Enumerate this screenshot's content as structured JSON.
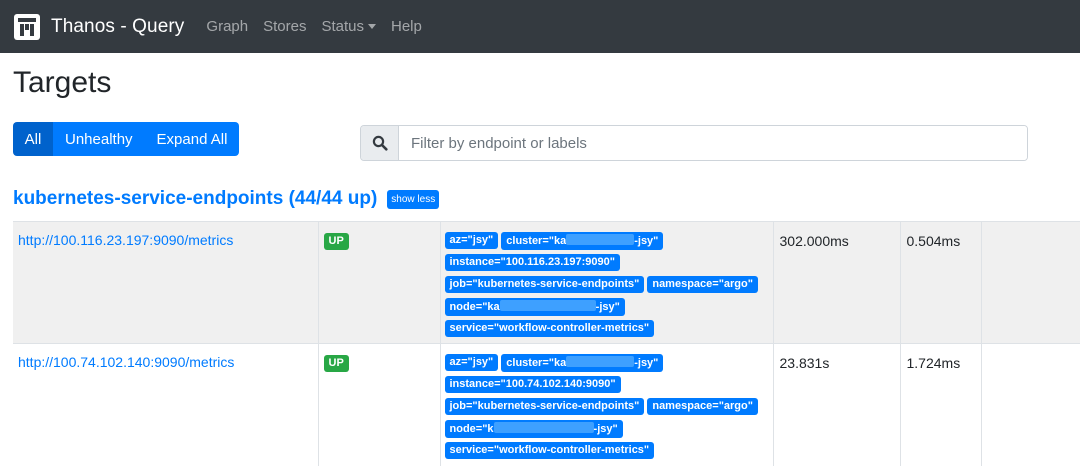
{
  "nav": {
    "brand": "Thanos - Query",
    "items": [
      {
        "label": "Graph"
      },
      {
        "label": "Stores"
      },
      {
        "label": "Status"
      },
      {
        "label": "Help"
      }
    ]
  },
  "page": {
    "title": "Targets"
  },
  "filters": {
    "all": "All",
    "unhealthy": "Unhealthy",
    "expand_all": "Expand All",
    "active": "All"
  },
  "search": {
    "placeholder": "Filter by endpoint or labels",
    "value": ""
  },
  "group": {
    "title": "kubernetes-service-endpoints (44/44 up)",
    "toggle_label": "show less"
  },
  "targets": [
    {
      "endpoint": "http://100.116.23.197:9090/metrics",
      "state": "UP",
      "labels": {
        "az": "az=\"jsy\"",
        "cluster_prefix": "cluster=\"ka",
        "cluster_suffix": "-jsy\"",
        "instance": "instance=\"100.116.23.197:9090\"",
        "job": "job=\"kubernetes-service-endpoints\"",
        "namespace": "namespace=\"argo\"",
        "node_prefix": "node=\"ka",
        "node_suffix": "-jsy\"",
        "service": "service=\"workflow-controller-metrics\""
      },
      "last_scrape": "302.000ms",
      "scrape_duration": "0.504ms"
    },
    {
      "endpoint": "http://100.74.102.140:9090/metrics",
      "state": "UP",
      "labels": {
        "az": "az=\"jsy\"",
        "cluster_prefix": "cluster=\"ka",
        "cluster_suffix": "-jsy\"",
        "instance": "instance=\"100.74.102.140:9090\"",
        "job": "job=\"kubernetes-service-endpoints\"",
        "namespace": "namespace=\"argo\"",
        "node_prefix": "node=\"k",
        "node_suffix": "-jsy\"",
        "service": "service=\"workflow-controller-metrics\""
      },
      "last_scrape": "23.831s",
      "scrape_duration": "1.724ms"
    }
  ],
  "colors": {
    "navbar": "#343a40",
    "primary": "#007bff",
    "success": "#28a745",
    "redacted": "#3ea0ff"
  }
}
